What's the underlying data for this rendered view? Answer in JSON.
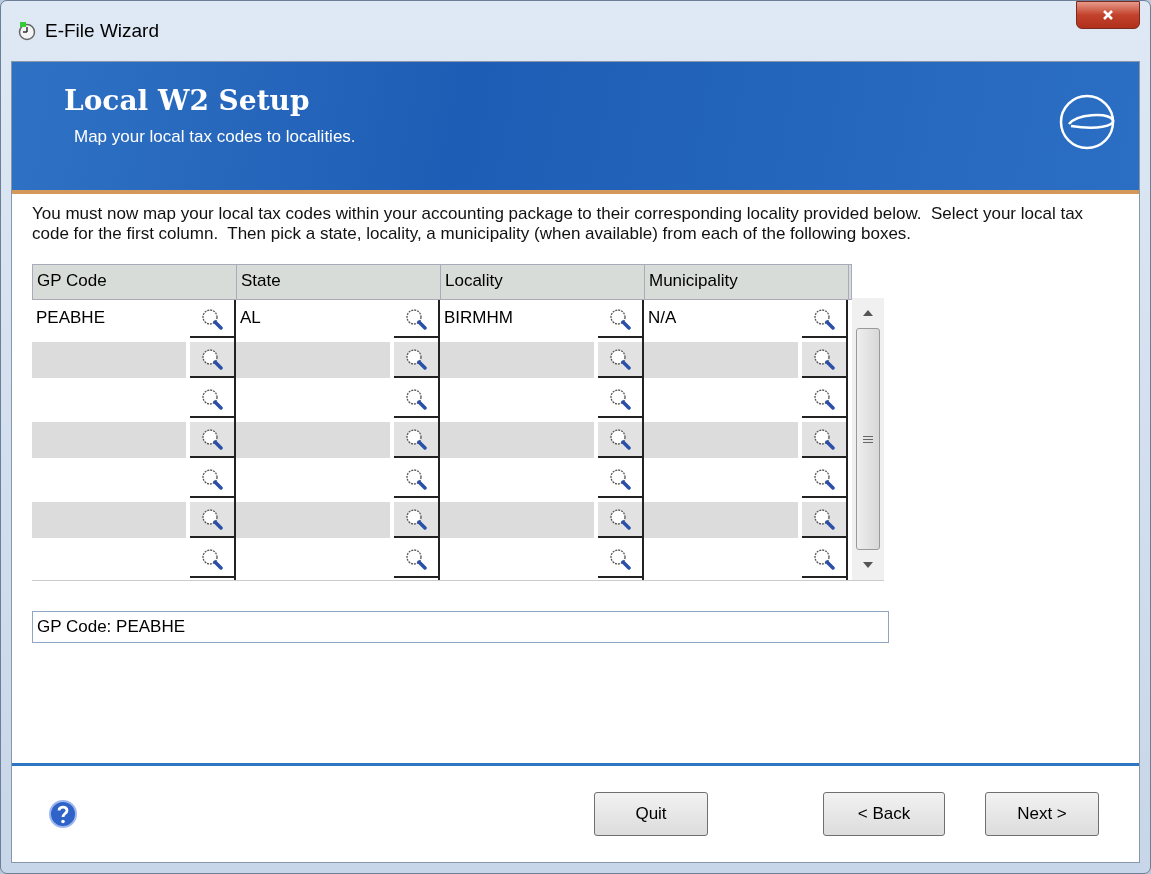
{
  "window": {
    "title": "E-File Wizard"
  },
  "banner": {
    "title": "Local W2 Setup",
    "subtitle": "Map your local tax codes to localities."
  },
  "instructions": "You must now map your local tax codes within your accounting package to their corresponding locality provided below.  Select your local tax code for the first column.  Then pick a state, locality, a municipality (when available) from each of the following boxes.",
  "table": {
    "columns": [
      "GP Code",
      "State",
      "Locality",
      "Municipality"
    ],
    "rows": [
      {
        "cells": [
          "PEABHE",
          "AL",
          "BIRMHM",
          "N/A"
        ]
      },
      {
        "cells": []
      },
      {
        "cells": []
      },
      {
        "cells": []
      },
      {
        "cells": []
      },
      {
        "cells": []
      },
      {
        "cells": []
      }
    ]
  },
  "status_field": "GP Code: PEABHE",
  "buttons": [
    {
      "label": "Quit"
    },
    {
      "label": "< Back"
    },
    {
      "label": "Next >"
    }
  ]
}
